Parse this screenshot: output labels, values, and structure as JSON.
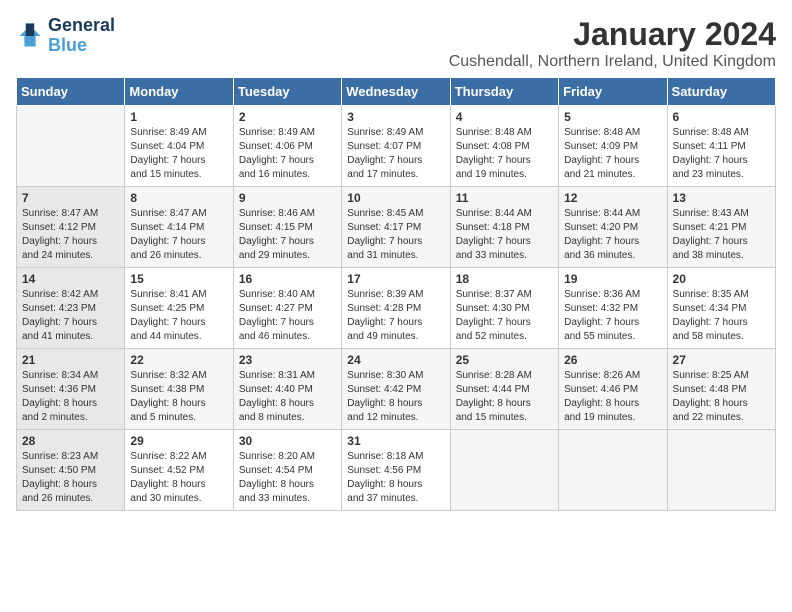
{
  "header": {
    "logo_line1": "General",
    "logo_line2": "Blue",
    "month_title": "January 2024",
    "location": "Cushendall, Northern Ireland, United Kingdom"
  },
  "days_of_week": [
    "Sunday",
    "Monday",
    "Tuesday",
    "Wednesday",
    "Thursday",
    "Friday",
    "Saturday"
  ],
  "weeks": [
    [
      {
        "day": "",
        "info": ""
      },
      {
        "day": "1",
        "info": "Sunrise: 8:49 AM\nSunset: 4:04 PM\nDaylight: 7 hours\nand 15 minutes."
      },
      {
        "day": "2",
        "info": "Sunrise: 8:49 AM\nSunset: 4:06 PM\nDaylight: 7 hours\nand 16 minutes."
      },
      {
        "day": "3",
        "info": "Sunrise: 8:49 AM\nSunset: 4:07 PM\nDaylight: 7 hours\nand 17 minutes."
      },
      {
        "day": "4",
        "info": "Sunrise: 8:48 AM\nSunset: 4:08 PM\nDaylight: 7 hours\nand 19 minutes."
      },
      {
        "day": "5",
        "info": "Sunrise: 8:48 AM\nSunset: 4:09 PM\nDaylight: 7 hours\nand 21 minutes."
      },
      {
        "day": "6",
        "info": "Sunrise: 8:48 AM\nSunset: 4:11 PM\nDaylight: 7 hours\nand 23 minutes."
      }
    ],
    [
      {
        "day": "7",
        "info": ""
      },
      {
        "day": "8",
        "info": "Sunrise: 8:47 AM\nSunset: 4:14 PM\nDaylight: 7 hours\nand 26 minutes."
      },
      {
        "day": "9",
        "info": "Sunrise: 8:46 AM\nSunset: 4:15 PM\nDaylight: 7 hours\nand 29 minutes."
      },
      {
        "day": "10",
        "info": "Sunrise: 8:45 AM\nSunset: 4:17 PM\nDaylight: 7 hours\nand 31 minutes."
      },
      {
        "day": "11",
        "info": "Sunrise: 8:44 AM\nSunset: 4:18 PM\nDaylight: 7 hours\nand 33 minutes."
      },
      {
        "day": "12",
        "info": "Sunrise: 8:44 AM\nSunset: 4:20 PM\nDaylight: 7 hours\nand 36 minutes."
      },
      {
        "day": "13",
        "info": "Sunrise: 8:43 AM\nSunset: 4:21 PM\nDaylight: 7 hours\nand 38 minutes."
      }
    ],
    [
      {
        "day": "14",
        "info": ""
      },
      {
        "day": "15",
        "info": "Sunrise: 8:41 AM\nSunset: 4:25 PM\nDaylight: 7 hours\nand 44 minutes."
      },
      {
        "day": "16",
        "info": "Sunrise: 8:40 AM\nSunset: 4:27 PM\nDaylight: 7 hours\nand 46 minutes."
      },
      {
        "day": "17",
        "info": "Sunrise: 8:39 AM\nSunset: 4:28 PM\nDaylight: 7 hours\nand 49 minutes."
      },
      {
        "day": "18",
        "info": "Sunrise: 8:37 AM\nSunset: 4:30 PM\nDaylight: 7 hours\nand 52 minutes."
      },
      {
        "day": "19",
        "info": "Sunrise: 8:36 AM\nSunset: 4:32 PM\nDaylight: 7 hours\nand 55 minutes."
      },
      {
        "day": "20",
        "info": "Sunrise: 8:35 AM\nSunset: 4:34 PM\nDaylight: 7 hours\nand 58 minutes."
      }
    ],
    [
      {
        "day": "21",
        "info": ""
      },
      {
        "day": "22",
        "info": "Sunrise: 8:32 AM\nSunset: 4:38 PM\nDaylight: 8 hours\nand 5 minutes."
      },
      {
        "day": "23",
        "info": "Sunrise: 8:31 AM\nSunset: 4:40 PM\nDaylight: 8 hours\nand 8 minutes."
      },
      {
        "day": "24",
        "info": "Sunrise: 8:30 AM\nSunset: 4:42 PM\nDaylight: 8 hours\nand 12 minutes."
      },
      {
        "day": "25",
        "info": "Sunrise: 8:28 AM\nSunset: 4:44 PM\nDaylight: 8 hours\nand 15 minutes."
      },
      {
        "day": "26",
        "info": "Sunrise: 8:26 AM\nSunset: 4:46 PM\nDaylight: 8 hours\nand 19 minutes."
      },
      {
        "day": "27",
        "info": "Sunrise: 8:25 AM\nSunset: 4:48 PM\nDaylight: 8 hours\nand 22 minutes."
      }
    ],
    [
      {
        "day": "28",
        "info": ""
      },
      {
        "day": "29",
        "info": "Sunrise: 8:22 AM\nSunset: 4:52 PM\nDaylight: 8 hours\nand 30 minutes."
      },
      {
        "day": "30",
        "info": "Sunrise: 8:20 AM\nSunset: 4:54 PM\nDaylight: 8 hours\nand 33 minutes."
      },
      {
        "day": "31",
        "info": "Sunrise: 8:18 AM\nSunset: 4:56 PM\nDaylight: 8 hours\nand 37 minutes."
      },
      {
        "day": "",
        "info": ""
      },
      {
        "day": "",
        "info": ""
      },
      {
        "day": "",
        "info": ""
      }
    ]
  ],
  "week1_sunday": "Sunrise: 8:47 AM\nSunset: 4:12 PM\nDaylight: 7 hours\nand 24 minutes.",
  "week3_sunday": "Sunrise: 8:42 AM\nSunset: 4:23 PM\nDaylight: 7 hours\nand 41 minutes.",
  "week4_sunday": "Sunrise: 8:34 AM\nSunset: 4:36 PM\nDaylight: 8 hours\nand 2 minutes.",
  "week5_sunday": "Sunrise: 8:23 AM\nSunset: 4:50 PM\nDaylight: 8 hours\nand 26 minutes."
}
